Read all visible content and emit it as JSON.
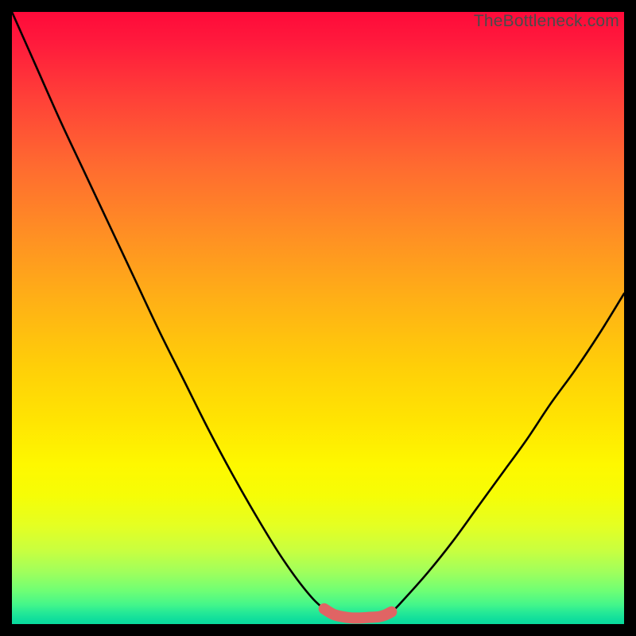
{
  "watermark": "TheBottleneck.com",
  "chart_data": {
    "type": "line",
    "title": "",
    "xlabel": "",
    "ylabel": "",
    "xlim": [
      0,
      100
    ],
    "ylim": [
      0,
      100
    ],
    "grid": false,
    "legend": false,
    "series": [
      {
        "name": "curve",
        "color": "#000000",
        "x": [
          0,
          4,
          8,
          12,
          16,
          20,
          24,
          28,
          32,
          36,
          40,
          44,
          48,
          51,
          54,
          57,
          60,
          62,
          64,
          68,
          72,
          76,
          80,
          84,
          88,
          92,
          96,
          100
        ],
        "y": [
          100,
          91,
          82,
          73.5,
          65,
          56.5,
          48,
          40,
          32,
          24.5,
          17.5,
          11,
          5.5,
          2.5,
          1.2,
          1.0,
          1.2,
          2.0,
          4.0,
          8.5,
          13.5,
          19,
          24.5,
          30,
          36,
          41.5,
          47.5,
          54
        ]
      },
      {
        "name": "highlight",
        "color": "#e06464",
        "x": [
          51,
          52.5,
          54,
          55.5,
          57,
          58.5,
          60,
          61,
          62
        ],
        "y": [
          2.5,
          1.6,
          1.2,
          1.0,
          1.0,
          1.1,
          1.2,
          1.5,
          2.0
        ]
      }
    ],
    "colors": {
      "gradient_top": "#ff0a3a",
      "gradient_mid": "#ffe502",
      "gradient_bottom": "#08da9d",
      "frame": "#000000",
      "highlight": "#e06464"
    }
  }
}
